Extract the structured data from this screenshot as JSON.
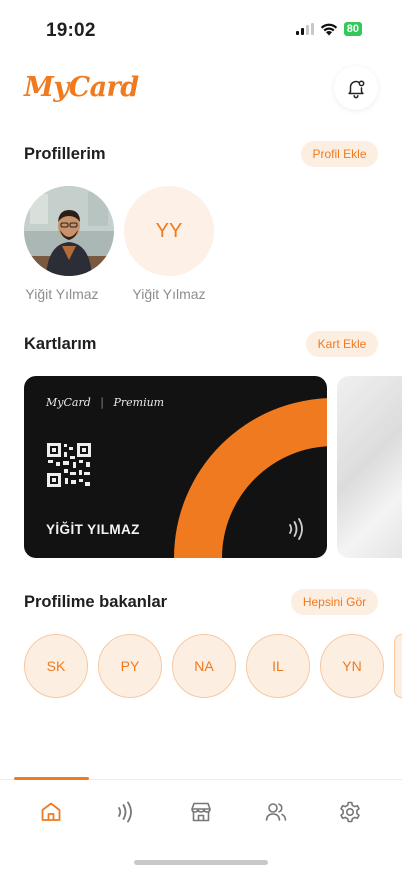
{
  "status_bar": {
    "time": "19:02",
    "battery": "80"
  },
  "header": {
    "logo": "MyCard",
    "bell_icon": "bell-icon"
  },
  "profiles_section": {
    "title": "Profillerim",
    "add_button": "Profil Ekle",
    "profiles": [
      {
        "name": "Yiğit Yılmaz",
        "type": "photo"
      },
      {
        "name": "Yiğit Yılmaz",
        "initials": "YY"
      }
    ]
  },
  "cards_section": {
    "title": "Kartlarım",
    "add_button": "Kart Ekle",
    "card": {
      "brand": "MyCard",
      "tier": "Premium",
      "holder": "YİĞİT YILMAZ"
    }
  },
  "viewers_section": {
    "title": "Profilime bakanlar",
    "see_all": "Hepsini Gör",
    "viewers": [
      "SK",
      "PY",
      "NA",
      "IL",
      "YN"
    ]
  },
  "bottom_nav": {
    "active": "home",
    "items": [
      "home-icon",
      "nfc-icon",
      "store-icon",
      "contacts-icon",
      "settings-icon"
    ]
  },
  "colors": {
    "accent": "#f07a1f",
    "accent_soft": "#fdeee2",
    "card_bg": "#121212"
  }
}
